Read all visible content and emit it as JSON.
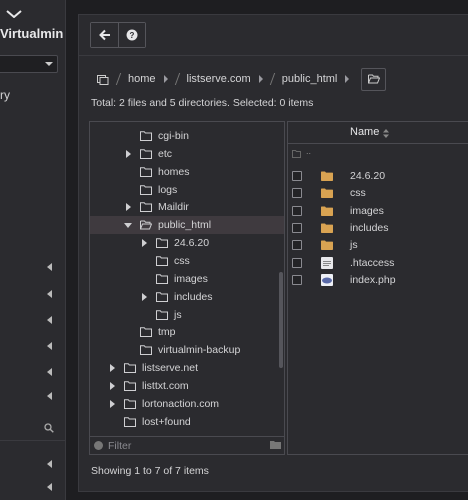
{
  "sidebar": {
    "brand": "Virtualmin",
    "label": "ry",
    "arrows": [
      267,
      294,
      320,
      346,
      372,
      396,
      464,
      487
    ]
  },
  "toolbar": {
    "back_icon": "arrow-left-icon",
    "help_icon": "question-circle-icon"
  },
  "breadcrumb": {
    "items": [
      "home",
      "listserve.com",
      "public_html"
    ]
  },
  "summary": "Total: 2 files and 5 directories. Selected: 0 items",
  "tree": {
    "rows": [
      {
        "label": "cgi-bin",
        "depth": 1,
        "toggle": "none"
      },
      {
        "label": "etc",
        "depth": 1,
        "toggle": "collapsed"
      },
      {
        "label": "homes",
        "depth": 1,
        "toggle": "none"
      },
      {
        "label": "logs",
        "depth": 1,
        "toggle": "none"
      },
      {
        "label": "Maildir",
        "depth": 1,
        "toggle": "collapsed"
      },
      {
        "label": "public_html",
        "depth": 1,
        "toggle": "expanded",
        "selected": true
      },
      {
        "label": "24.6.20",
        "depth": 2,
        "toggle": "collapsed"
      },
      {
        "label": "css",
        "depth": 2,
        "toggle": "none"
      },
      {
        "label": "images",
        "depth": 2,
        "toggle": "none"
      },
      {
        "label": "includes",
        "depth": 2,
        "toggle": "collapsed"
      },
      {
        "label": "js",
        "depth": 2,
        "toggle": "none"
      },
      {
        "label": "tmp",
        "depth": 1,
        "toggle": "none"
      },
      {
        "label": "virtualmin-backup",
        "depth": 1,
        "toggle": "none"
      },
      {
        "label": "listserve.net",
        "depth": 0,
        "toggle": "collapsed"
      },
      {
        "label": "listtxt.com",
        "depth": 0,
        "toggle": "collapsed"
      },
      {
        "label": "lortonaction.com",
        "depth": 0,
        "toggle": "collapsed"
      },
      {
        "label": "lost+found",
        "depth": 0,
        "toggle": "none"
      }
    ],
    "filter_placeholder": "Filter"
  },
  "files": {
    "column_name": "Name",
    "up_label": "..",
    "rows": [
      {
        "name": "24.6.20",
        "kind": "folder"
      },
      {
        "name": "css",
        "kind": "folder"
      },
      {
        "name": "images",
        "kind": "folder"
      },
      {
        "name": "includes",
        "kind": "folder"
      },
      {
        "name": "js",
        "kind": "folder"
      },
      {
        "name": ".htaccess",
        "kind": "text"
      },
      {
        "name": "index.php",
        "kind": "php"
      }
    ]
  },
  "footer": "Showing 1 to 7 of 7 items",
  "colors": {
    "folder": "#d9a352",
    "background": "#1e1e21",
    "panel": "#2b2b2f",
    "selected_row": "#3f3a3f"
  }
}
